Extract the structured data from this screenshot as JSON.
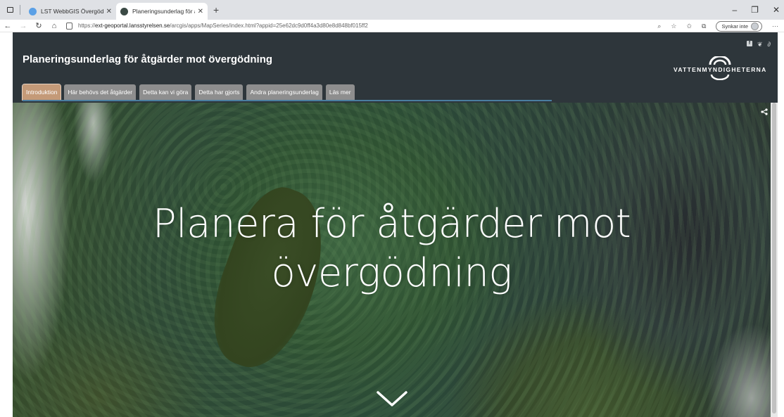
{
  "browser": {
    "tabs": [
      {
        "title": "LST WebbGIS Övergödningskarta",
        "active": false,
        "favicon_color": "#5aa0e6"
      },
      {
        "title": "Planeringsunderlag för åtgärder",
        "active": true,
        "favicon_color": "#3b4a45"
      }
    ],
    "new_tab_label": "+",
    "url_prefix": "https://",
    "url_host": "ext-geoportal.lansstyrelsen.se",
    "url_path": "/arcgis/apps/MapSeries/index.html?appid=25e62dc9d0ff4a3d80e8d848bf015ff2",
    "sync_label": "Synkar inte",
    "window_controls": [
      "–",
      "❐",
      "✕"
    ]
  },
  "header": {
    "title": "Planeringsunderlag för åtgärder mot övergödning",
    "logo_text": "VATTENMYNDIGHETERNA",
    "social": [
      "facebook-icon",
      "twitter-icon",
      "link-icon"
    ]
  },
  "nav": {
    "tabs": [
      {
        "label": "Introduktion",
        "active": true
      },
      {
        "label": "Här behövs det åtgärder",
        "active": false
      },
      {
        "label": "Detta kan vi göra",
        "active": false
      },
      {
        "label": "Detta har gjorts",
        "active": false
      },
      {
        "label": "Andra planeringsunderlag",
        "active": false
      },
      {
        "label": "Läs mer",
        "active": false
      }
    ]
  },
  "hero": {
    "title_line1": "Planera för åtgärder mot",
    "title_line2": "övergödning"
  },
  "colors": {
    "header_bg": "#2e363b",
    "tab_bg": "#8e8e8e",
    "tab_active_bg": "#c49a78",
    "accent_line": "#4a7ea0"
  }
}
